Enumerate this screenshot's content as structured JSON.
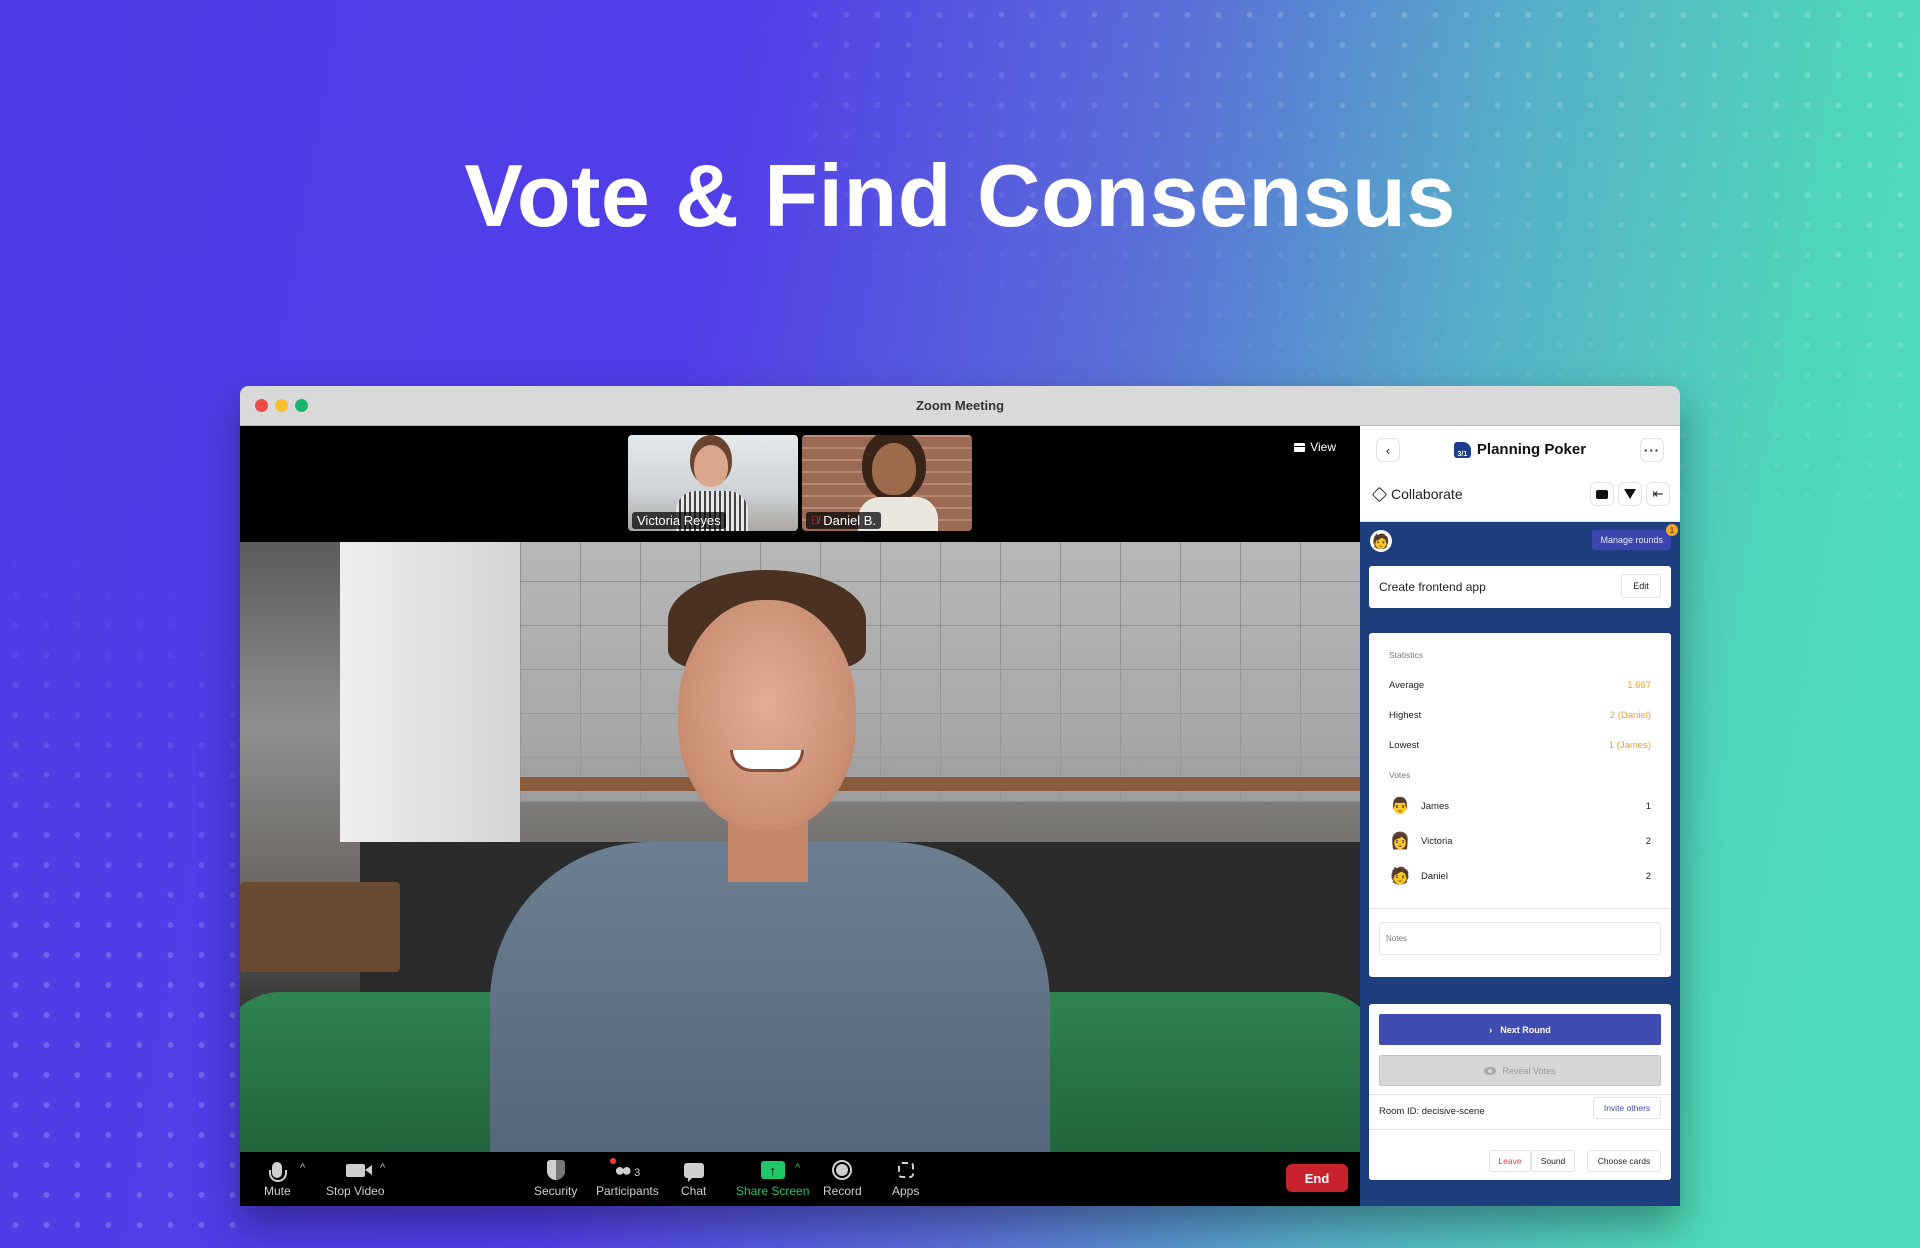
{
  "headline": "Vote & Find Consensus",
  "window": {
    "title": "Zoom Meeting",
    "traffic_lights": [
      "close",
      "minimize",
      "zoom"
    ]
  },
  "video": {
    "thumbnails": [
      {
        "name": "Victoria Reyes",
        "muted": false
      },
      {
        "name": "Daniel B.",
        "muted": true
      }
    ],
    "view_label": "View"
  },
  "toolbar": {
    "items": [
      {
        "label": "Mute",
        "icon": "microphone-icon",
        "has_caret": true
      },
      {
        "label": "Stop Video",
        "icon": "video-camera-icon",
        "has_caret": true
      },
      {
        "label": "Security",
        "icon": "shield-icon"
      },
      {
        "label": "Participants",
        "icon": "participants-icon",
        "count": "3"
      },
      {
        "label": "Chat",
        "icon": "chat-bubble-icon"
      },
      {
        "label": "Share Screen",
        "icon": "share-screen-icon",
        "has_caret": true
      },
      {
        "label": "Record",
        "icon": "record-icon"
      },
      {
        "label": "Apps",
        "icon": "apps-icon"
      }
    ],
    "end_label": "End"
  },
  "panel": {
    "title": "Planning Poker",
    "logo_text": "3/1",
    "section": "Collaborate",
    "manage_rounds": "Manage rounds",
    "manage_badge": "1",
    "task": {
      "name": "Create frontend app",
      "edit_label": "Edit"
    },
    "statistics": {
      "label": "Statistics",
      "rows": [
        {
          "label": "Average",
          "value": "1.667"
        },
        {
          "label": "Highest",
          "value": "2 (Daniel)"
        },
        {
          "label": "Lowest",
          "value": "1 (James)"
        }
      ]
    },
    "votes": {
      "label": "Votes",
      "rows": [
        {
          "name": "James",
          "value": "1",
          "avatar": "👨"
        },
        {
          "name": "Victoria",
          "value": "2",
          "avatar": "👩"
        },
        {
          "name": "Daniel",
          "value": "2",
          "avatar": "🧑"
        }
      ]
    },
    "notes_placeholder": "Notes",
    "next_round": "Next Round",
    "reveal_votes": "Reveal Votes",
    "room_id_label": "Room ID: ",
    "room_id": "decisive-scene",
    "invite": "Invite others",
    "leave": "Leave",
    "sound": "Sound",
    "choose_cards": "Choose cards",
    "colors": {
      "panel_bg": "#1e3f7e",
      "primary": "#3f4db2",
      "stat_value": "#f5a02c",
      "leave": "#ee3a3a",
      "share_green": "#1ec768",
      "end_red": "#c8232c"
    }
  }
}
